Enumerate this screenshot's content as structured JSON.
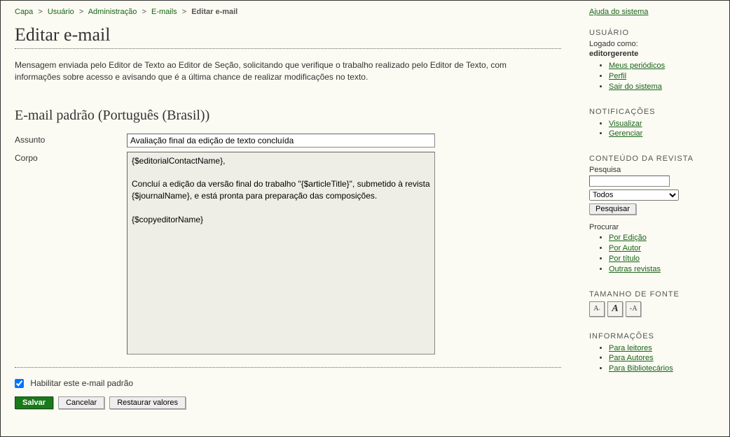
{
  "breadcrumb": {
    "items": [
      "Capa",
      "Usuário",
      "Administração",
      "E-mails"
    ],
    "current": "Editar e-mail"
  },
  "page": {
    "title": "Editar e-mail",
    "description": "Mensagem enviada pelo Editor de Texto ao Editor de Seção, solicitando que verifique o trabalho realizado pelo Editor de Texto, com informações sobre acesso e avisando que é a última chance de realizar modificações no texto.",
    "subheading": "E-mail padrão (Português (Brasil))"
  },
  "form": {
    "subject_label": "Assunto",
    "subject_value": "Avaliação final da edição de texto concluída",
    "body_label": "Corpo",
    "body_value": "{$editorialContactName},\n\nConcluí a edição da versão final do trabalho \"{$articleTitle}\", submetido à revista {$journalName}, e está pronta para preparação das composições.\n\n{$copyeditorName}",
    "enable_label": "Habilitar este e-mail padrão",
    "enable_checked": true,
    "save_label": "Salvar",
    "cancel_label": "Cancelar",
    "restore_label": "Restaurar valores"
  },
  "sidebar": {
    "help_link": "Ajuda do sistema",
    "user": {
      "title": "USUÁRIO",
      "logged_as": "Logado como:",
      "username": "editorgerente",
      "links": [
        "Meus periódicos",
        "Perfil",
        "Sair do sistema"
      ]
    },
    "notifications": {
      "title": "NOTIFICAÇÕES",
      "links": [
        "Visualizar",
        "Gerenciar"
      ]
    },
    "content": {
      "title": "CONTEÚDO DA REVISTA",
      "search_label": "Pesquisa",
      "select_value": "Todos",
      "search_button": "Pesquisar",
      "browse_label": "Procurar",
      "browse_links": [
        "Por Edição",
        "Por Autor",
        "Por título",
        "Outras revistas"
      ]
    },
    "fontsize": {
      "title": "TAMANHO DE FONTE"
    },
    "info": {
      "title": "INFORMAÇÕES",
      "links": [
        "Para leitores",
        "Para Autores",
        "Para Bibliotecários"
      ]
    }
  }
}
